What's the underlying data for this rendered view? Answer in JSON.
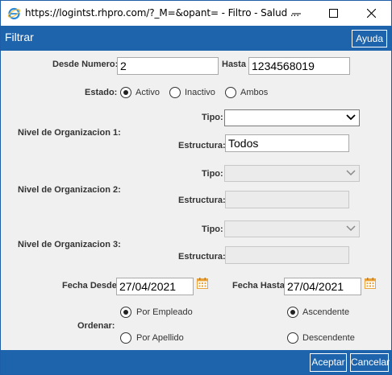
{
  "window": {
    "title": "https://logintst.rhpro.com/?_M=&opant= - Filtro - Salud ...",
    "controls": [
      "minimize-icon",
      "maximize-icon",
      "close-icon"
    ]
  },
  "header": {
    "title": "Filtrar",
    "help_label": "Ayuda"
  },
  "form": {
    "desde_numero_label": "Desde Numero:",
    "desde_numero_value": "2",
    "hasta_label": "Hasta",
    "hasta_value": "1234568019",
    "estado_label": "Estado:",
    "estado_options": [
      "Activo",
      "Inactivo",
      "Ambos"
    ],
    "estado_selected": "Activo",
    "nivel1": {
      "label": "Nivel de Organizacion 1:",
      "tipo_label": "Tipo:",
      "tipo_value": "",
      "estructura_label": "Estructura:",
      "estructura_value": "Todos"
    },
    "nivel2": {
      "label": "Nivel de Organizacion 2:",
      "tipo_label": "Tipo:",
      "estructura_label": "Estructura:"
    },
    "nivel3": {
      "label": "Nivel de Organizacion 3:",
      "tipo_label": "Tipo:",
      "estructura_label": "Estructura:"
    },
    "fecha_desde_label": "Fecha Desde:",
    "fecha_desde_value": "27/04/2021",
    "fecha_hasta_label": "Fecha Hasta:",
    "fecha_hasta_value": "27/04/2021",
    "ordenar_label": "Ordenar:",
    "orden_by": [
      "Por Empleado",
      "Por Apellido"
    ],
    "orden_by_selected": "Por Empleado",
    "orden_dir": [
      "Ascendente",
      "Descendente"
    ],
    "orden_dir_selected": "Ascendente"
  },
  "footer": {
    "accept_label": "Aceptar",
    "cancel_label": "Cancelar"
  },
  "colors": {
    "accent": "#1d64ad",
    "background": "#f0f0f0",
    "calendar": "#e8a33a"
  }
}
